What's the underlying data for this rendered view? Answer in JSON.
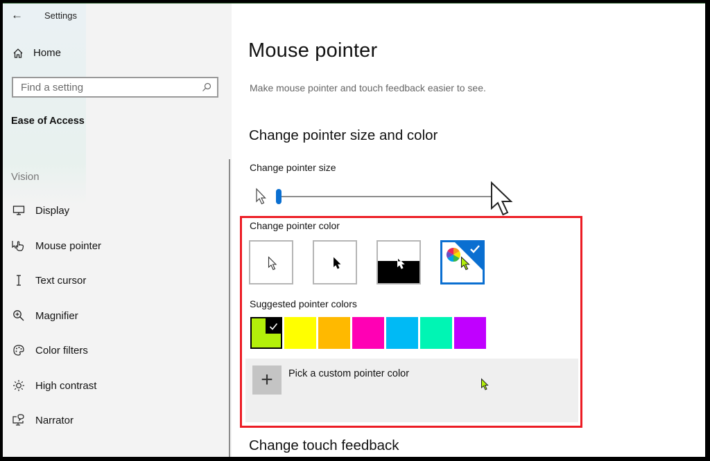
{
  "window": {
    "title": "Settings",
    "back_icon": "arrow-left-icon"
  },
  "sidebar": {
    "home_label": "Home",
    "search": {
      "placeholder": "Find a setting",
      "value": ""
    },
    "section_title": "Ease of Access",
    "group_label": "Vision",
    "items": [
      {
        "label": "Display",
        "icon": "monitor-icon"
      },
      {
        "label": "Mouse pointer",
        "icon": "hand-pointer-icon",
        "selected": true
      },
      {
        "label": "Text cursor",
        "icon": "text-cursor-icon"
      },
      {
        "label": "Magnifier",
        "icon": "magnifier-icon"
      },
      {
        "label": "Color filters",
        "icon": "palette-icon"
      },
      {
        "label": "High contrast",
        "icon": "sun-icon"
      },
      {
        "label": "Narrator",
        "icon": "narrator-icon"
      }
    ]
  },
  "main": {
    "title": "Mouse pointer",
    "description": "Make mouse pointer and touch feedback easier to see.",
    "size_color_heading": "Change pointer size and color",
    "size_label": "Change pointer size",
    "pointer_size": {
      "value": 1,
      "min": 1,
      "max": 15
    },
    "color_label": "Change pointer color",
    "color_options": [
      {
        "name": "white",
        "selected": false
      },
      {
        "name": "black",
        "selected": false
      },
      {
        "name": "inverted",
        "selected": false
      },
      {
        "name": "custom",
        "selected": true
      }
    ],
    "suggested_label": "Suggested pointer colors",
    "suggested_colors": [
      {
        "hex": "#b3f00a",
        "selected": true
      },
      {
        "hex": "#ffff00",
        "selected": false
      },
      {
        "hex": "#ffb900",
        "selected": false
      },
      {
        "hex": "#ff00b4",
        "selected": false
      },
      {
        "hex": "#00baf5",
        "selected": false
      },
      {
        "hex": "#00f5b4",
        "selected": false
      },
      {
        "hex": "#c000ff",
        "selected": false
      }
    ],
    "custom_color_label": "Pick a custom pointer color",
    "touch_heading": "Change touch feedback"
  },
  "colors": {
    "accent": "#0a6fd1",
    "highlight_box": "#ec1c24"
  }
}
